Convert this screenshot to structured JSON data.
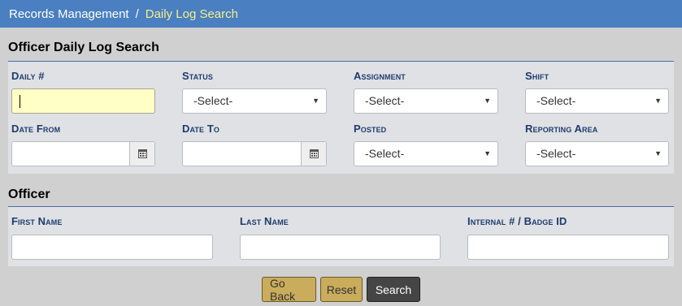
{
  "breadcrumb": {
    "root": "Records Management",
    "separator": "/",
    "current": "Daily Log Search"
  },
  "search_section": {
    "title": "Officer Daily Log Search",
    "fields": {
      "daily_no": {
        "label": "Daily #",
        "value": ""
      },
      "status": {
        "label": "Status",
        "selected": "-Select-"
      },
      "assignment": {
        "label": "Assignment",
        "selected": "-Select-"
      },
      "shift": {
        "label": "Shift",
        "selected": "-Select-"
      },
      "date_from": {
        "label": "Date From",
        "value": ""
      },
      "date_to": {
        "label": "Date To",
        "value": ""
      },
      "posted": {
        "label": "Posted",
        "selected": "-Select-"
      },
      "reporting_area": {
        "label": "Reporting Area",
        "selected": "-Select-"
      }
    }
  },
  "officer_section": {
    "title": "Officer",
    "fields": {
      "first_name": {
        "label": "First Name",
        "value": ""
      },
      "last_name": {
        "label": "Last Name",
        "value": ""
      },
      "badge_id": {
        "label": "Internal # / Badge ID",
        "value": ""
      }
    }
  },
  "actions": {
    "go_back": "Go Back",
    "reset": "Reset",
    "search": "Search"
  },
  "icons": {
    "dropdown": "chevron-down-icon",
    "calendar": "calendar-icon"
  },
  "colors": {
    "header_bar": "#4a7fc1",
    "breadcrumb_current": "#f5f08a",
    "label": "#1f3c6e",
    "focused_input": "#ffffc6",
    "button_gold": "#c9ac5c",
    "button_dark": "#454545"
  }
}
